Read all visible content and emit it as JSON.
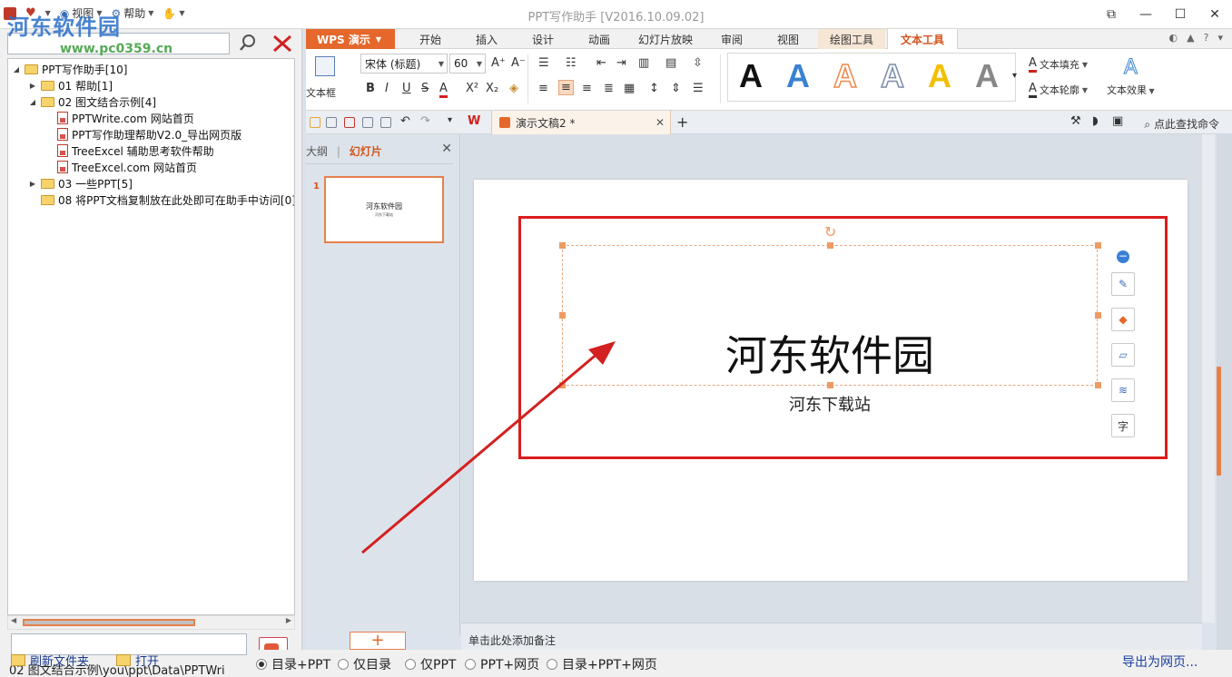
{
  "app": {
    "title": "PPT写作助手 [V2016.10.09.02]",
    "menu": [
      "视图",
      "帮助"
    ],
    "watermark_logo": "河东软件园",
    "watermark_url": "www.pc0359.cn"
  },
  "tree": {
    "root": "PPT写作助手[10]",
    "items": [
      {
        "label": "01 帮助[1]",
        "type": "folder",
        "level": 1,
        "expanded": false
      },
      {
        "label": "02 图文结合示例[4]",
        "type": "folder",
        "level": 1,
        "expanded": true
      },
      {
        "label": "PPTWrite.com 网站首页",
        "type": "doc",
        "level": 2
      },
      {
        "label": "PPT写作助理帮助V2.0_导出网页版",
        "type": "doc",
        "level": 2
      },
      {
        "label": "TreeExcel 辅助思考软件帮助",
        "type": "doc",
        "level": 2
      },
      {
        "label": "TreeExcel.com 网站首页",
        "type": "doc",
        "level": 2
      },
      {
        "label": "03 一些PPT[5]",
        "type": "folder",
        "level": 1,
        "expanded": false
      },
      {
        "label": "08 将PPT文档复制放在此处即可在助手中访问[0]",
        "type": "folder",
        "level": 1,
        "expanded": false
      }
    ]
  },
  "left_footer": {
    "path": "02 图文结合示例\\you\\ppt\\Data\\PPTWri",
    "refresh": "刷新文件夹",
    "open": "打开"
  },
  "wps": {
    "logo": "WPS 演示",
    "tabs": [
      "开始",
      "插入",
      "设计",
      "动画",
      "幻灯片放映",
      "审阅",
      "视图",
      "绘图工具",
      "文本工具"
    ],
    "active_tab": "文本工具",
    "ribbon": {
      "textbox_label": "文本框",
      "font_name": "宋体 (标题)",
      "font_size": "60",
      "text_fill": "文本填充",
      "text_outline": "文本轮廓",
      "text_effect": "文本效果",
      "style_colors": [
        "#111111",
        "#3a82d0",
        "#ee8a4c",
        "#7a8ca8",
        "#f2c000",
        "#888888"
      ]
    },
    "doc_tab": "演示文稿2 *",
    "find_cmd": "点此查找命令",
    "panel_tabs": [
      "大纲",
      "幻灯片"
    ],
    "active_panel_tab": "幻灯片",
    "thumb_number": "1",
    "slide": {
      "title": "河东软件园",
      "subtitle": "河东下载站"
    },
    "notes_placeholder": "单击此处添加备注"
  },
  "bottom": {
    "options": [
      "目录+PPT",
      "仅目录",
      "仅PPT",
      "PPT+网页",
      "目录+PPT+网页"
    ],
    "selected": "目录+PPT",
    "export": "导出为网页..."
  },
  "colors": {
    "accent": "#e5672b",
    "annotation": "#dc1c1c"
  }
}
